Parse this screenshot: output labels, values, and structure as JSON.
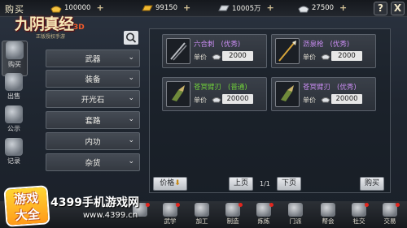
{
  "header": {
    "title": "购买",
    "resources": [
      {
        "icon": "gold-ingot-icon",
        "value": "100000"
      },
      {
        "icon": "gold-bar-icon",
        "value": "99150"
      },
      {
        "icon": "silver-bar-icon",
        "value": "10005万"
      },
      {
        "icon": "silver-ingot-icon",
        "value": "27500"
      }
    ],
    "plus": "+",
    "help_label": "?",
    "close_label": "X"
  },
  "logo": {
    "title": "九阴真经",
    "edition": "3D",
    "subtitle": "正版授权手游"
  },
  "left_tabs": [
    {
      "label": "购买",
      "icon": "scroll-icon",
      "active": true
    },
    {
      "label": "出售",
      "icon": "bag-icon",
      "active": false
    },
    {
      "label": "公示",
      "icon": "notice-icon",
      "active": false
    },
    {
      "label": "记录",
      "icon": "record-icon",
      "active": false
    }
  ],
  "categories": [
    "武器",
    "装备",
    "开光石",
    "套路",
    "内功",
    "杂货"
  ],
  "items": [
    {
      "name": "六合刺",
      "grade": "(优秀)",
      "quality": "excellent",
      "price_label": "单价",
      "price": "2000",
      "icon": "dagger-icon"
    },
    {
      "name": "沥泉枪",
      "grade": "(优秀)",
      "quality": "excellent",
      "price_label": "单价",
      "price": "2000",
      "icon": "spear-icon"
    },
    {
      "name": "苍冥臂刃",
      "grade": "(普通)",
      "quality": "normal",
      "price_label": "单价",
      "price": "20000",
      "icon": "arm-blade-icon"
    },
    {
      "name": "苍冥臂刃",
      "grade": "(优秀)",
      "quality": "excellent",
      "price_label": "单价",
      "price": "20000",
      "icon": "arm-blade-icon"
    }
  ],
  "pager": {
    "sort_label": "价格",
    "prev_label": "上页",
    "page_info": "1/1",
    "next_label": "下页",
    "buy_label": "购买"
  },
  "bottom_nav": [
    {
      "label": "",
      "icon": "menu-icon"
    },
    {
      "label": "武学",
      "icon": "martial-icon"
    },
    {
      "label": "加工",
      "icon": "craft-icon"
    },
    {
      "label": "制造",
      "icon": "forge-icon"
    },
    {
      "label": "炼炼",
      "icon": "refine-icon"
    },
    {
      "label": "门派",
      "icon": "sect-icon"
    },
    {
      "label": "帮会",
      "icon": "guild-icon"
    },
    {
      "label": "社交",
      "icon": "social-icon"
    },
    {
      "label": "交易",
      "icon": "trade-icon"
    }
  ],
  "watermark": {
    "badge_top": "游戏",
    "badge_bottom": "大全",
    "site_name": "4399手机游戏网",
    "url": "www.4399.cn"
  },
  "colors": {
    "excellent": "#c98cf2",
    "normal": "#6fcf3a",
    "red_dot": "#e2261e"
  }
}
